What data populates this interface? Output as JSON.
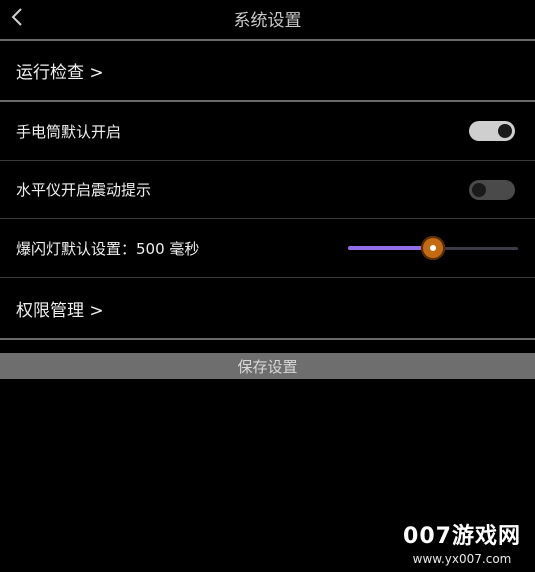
{
  "header": {
    "title": "系统设置",
    "back_icon": "chevron-left-icon"
  },
  "settings": {
    "run_check": {
      "label": "运行检查 >"
    },
    "flashlight": {
      "label": "手电筒默认开启",
      "enabled": true
    },
    "level_vibration": {
      "label": "水平仪开启震动提示",
      "enabled": false
    },
    "strobe": {
      "label": "爆闪灯默认设置：500 毫秒",
      "value_fraction": 0.5
    },
    "permissions": {
      "label": "权限管理 >"
    }
  },
  "save_button": {
    "label": "保存设置"
  },
  "colors": {
    "background": "#000000",
    "slider_fill": "#8f6ee6",
    "slider_thumb": "#c46a10",
    "toggle_on": "#cfcfcf",
    "toggle_off": "#4a4a4a",
    "save_bar": "#6e6e6e"
  },
  "watermark": {
    "brand": "007游戏网",
    "url": "www.yx007.com"
  }
}
